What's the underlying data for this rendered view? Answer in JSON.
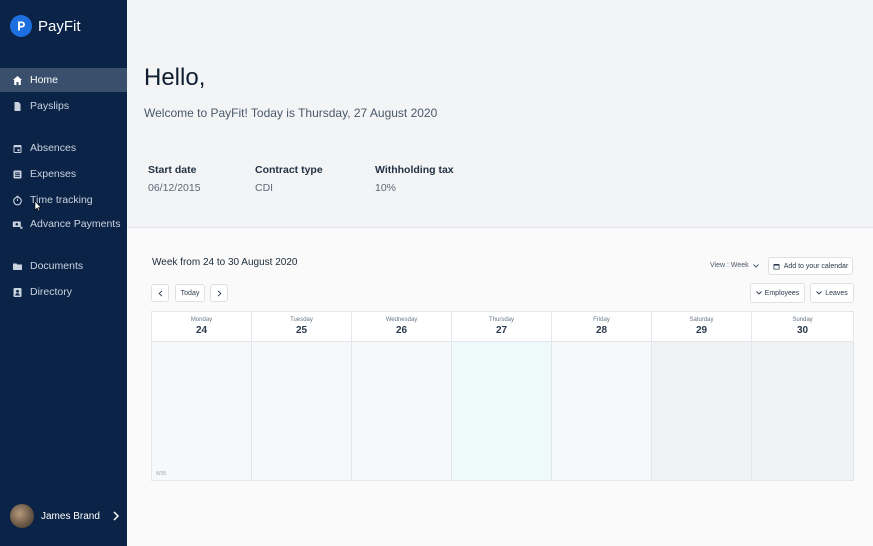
{
  "app": {
    "name": "PayFit"
  },
  "sidebar": {
    "items": [
      {
        "label": "Home",
        "icon": "home-icon",
        "active": true
      },
      {
        "label": "Payslips",
        "icon": "document-icon"
      },
      {
        "label": "Absences",
        "icon": "calendar-icon"
      },
      {
        "label": "Expenses",
        "icon": "list-icon"
      },
      {
        "label": "Time tracking",
        "icon": "stopwatch-icon"
      },
      {
        "label": "Advance Payments",
        "icon": "money-icon"
      },
      {
        "label": "Documents",
        "icon": "folder-icon"
      },
      {
        "label": "Directory",
        "icon": "contacts-icon"
      }
    ],
    "user": {
      "name": "James Brand"
    }
  },
  "hero": {
    "greeting": "Hello,",
    "welcome": "Welcome to PayFit! Today is Thursday, 27 August 2020",
    "info": [
      {
        "label": "Start date",
        "value": "06/12/2015"
      },
      {
        "label": "Contract type",
        "value": "CDI"
      },
      {
        "label": "Withholding tax",
        "value": "10%"
      }
    ]
  },
  "calendar": {
    "week_title": "Week from 24 to 30 August 2020",
    "view_label": "View : Week",
    "add_calendar": "Add to your calendar",
    "today_button": "Today",
    "employees_filter": "Employees",
    "leaves_filter": "Leaves",
    "week_number": "W35",
    "days": [
      {
        "name": "Monday",
        "num": "24"
      },
      {
        "name": "Tuesday",
        "num": "25"
      },
      {
        "name": "Wednesday",
        "num": "26"
      },
      {
        "name": "Thursday",
        "num": "27",
        "today": true
      },
      {
        "name": "Friday",
        "num": "28"
      },
      {
        "name": "Saturday",
        "num": "29",
        "weekend": true
      },
      {
        "name": "Sunday",
        "num": "30",
        "weekend": true
      }
    ]
  },
  "colors": {
    "sidebar_bg": "#0b2347",
    "active_item_bg": "#3a4f6b",
    "brand_blue": "#1d6fe0",
    "today_highlight": "#eefaf9"
  }
}
